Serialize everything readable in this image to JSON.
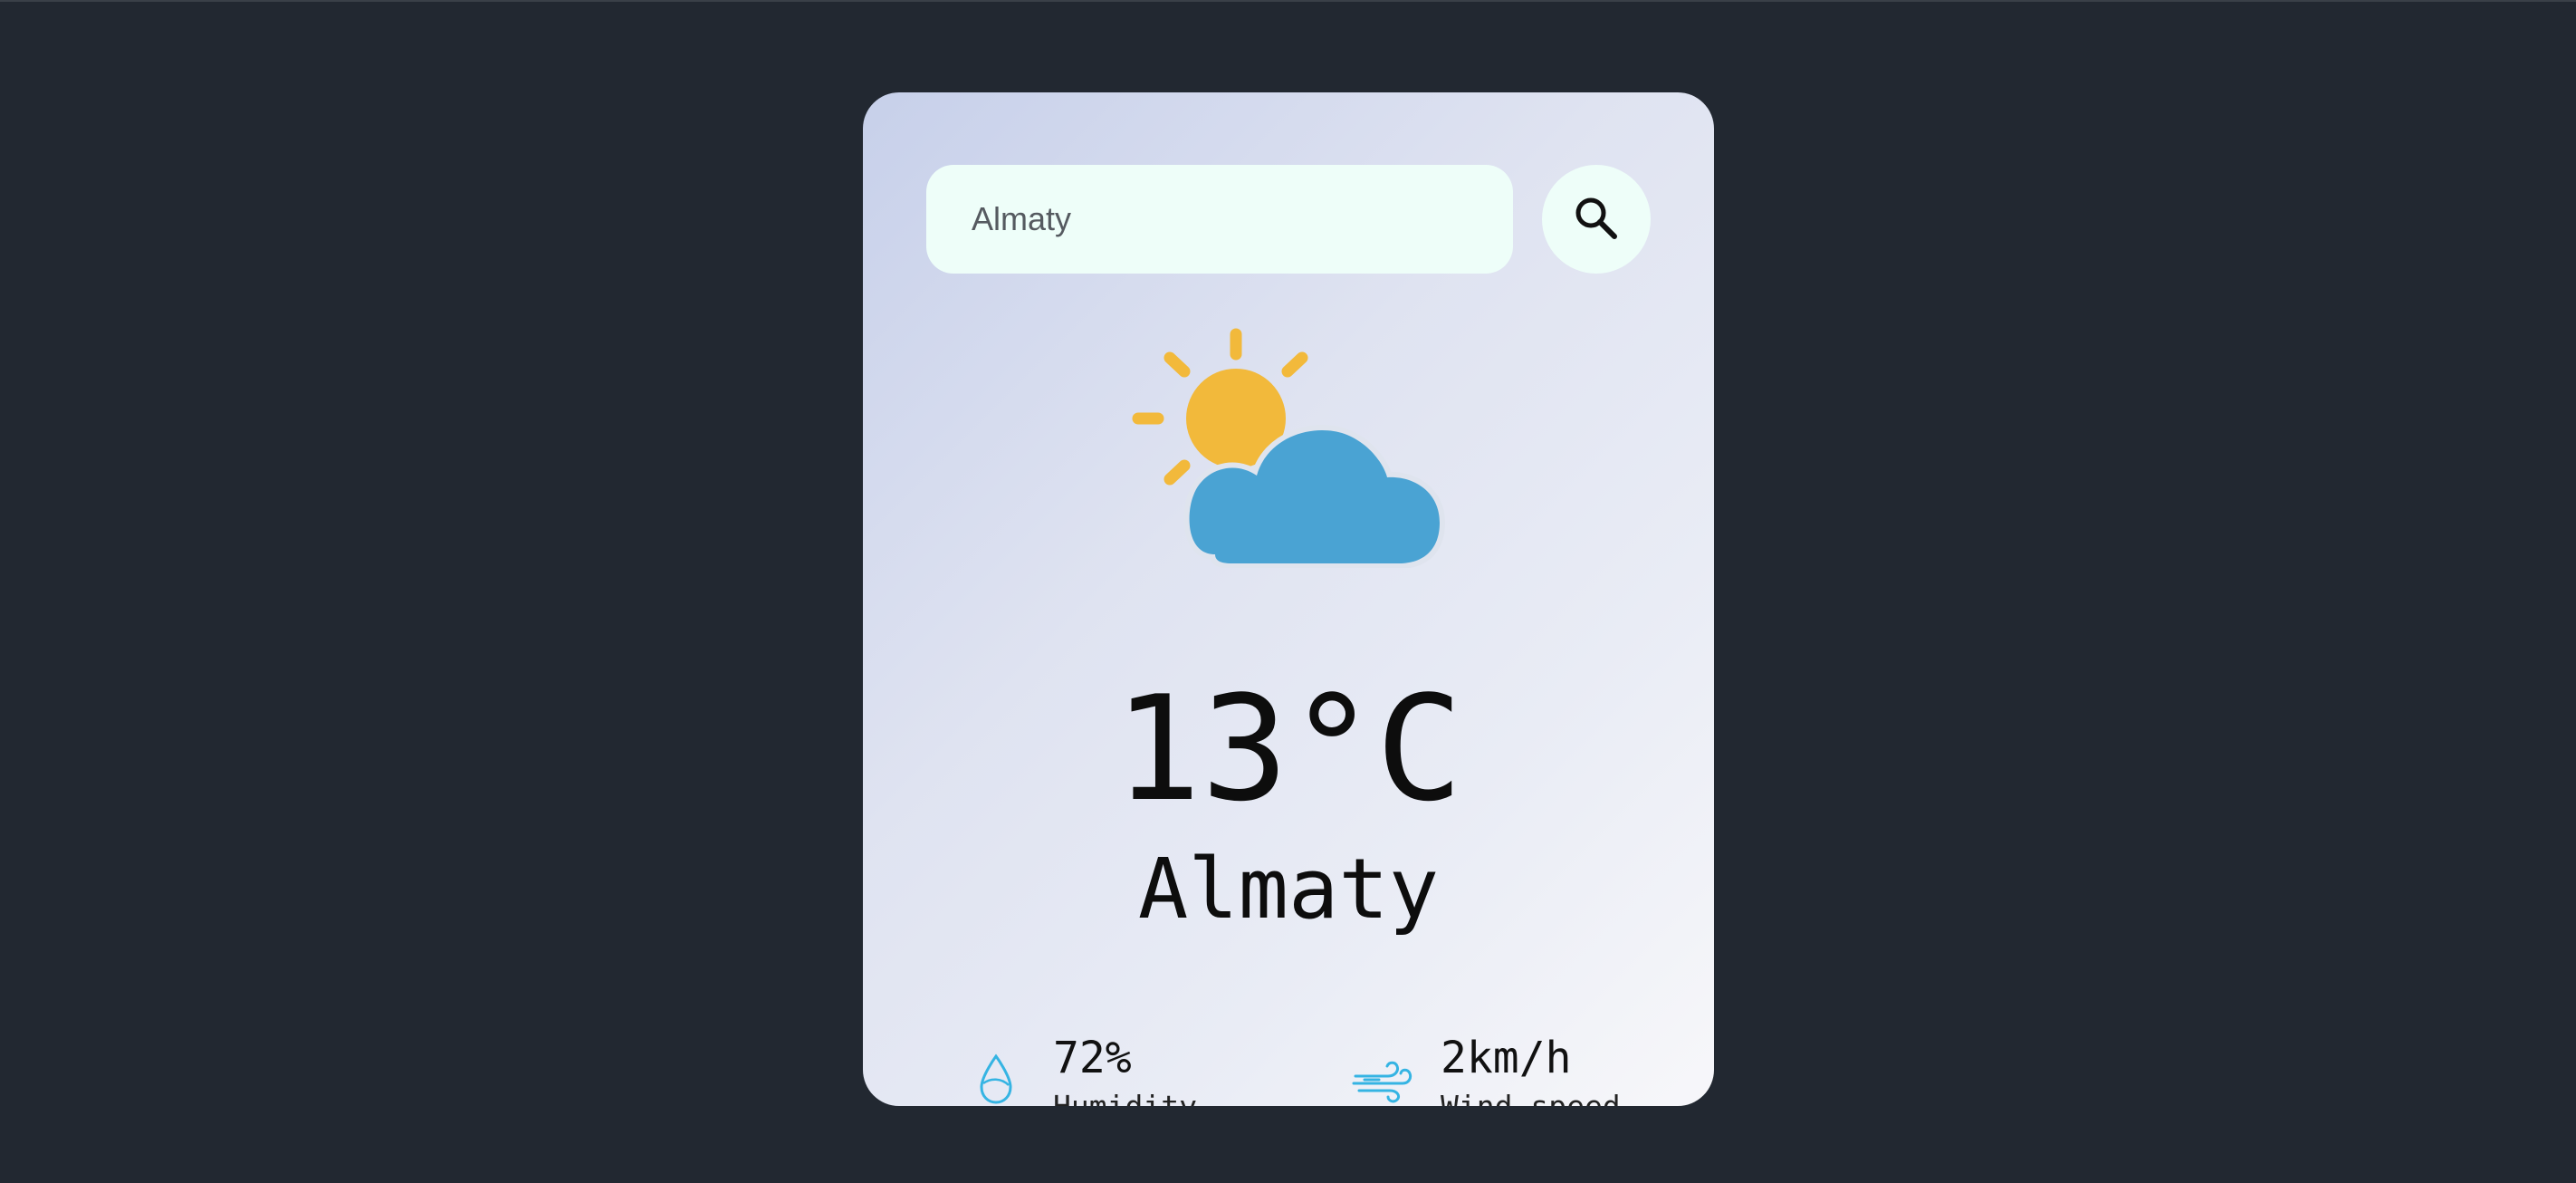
{
  "search": {
    "value": "Almaty",
    "icon": "search-icon"
  },
  "weather": {
    "icon": "partly-cloudy-icon",
    "temperature": "13°C",
    "city": "Almaty"
  },
  "details": {
    "humidity": {
      "icon": "humidity-icon",
      "value": "72%",
      "label": "Humidity"
    },
    "wind": {
      "icon": "wind-icon",
      "value": "2km/h",
      "label": "Wind speed"
    }
  },
  "colors": {
    "background": "#222831",
    "input_background": "#eefef9",
    "sun": "#f2b93b",
    "cloud": "#4aa3d3",
    "detail_icon": "#35b4e3"
  }
}
